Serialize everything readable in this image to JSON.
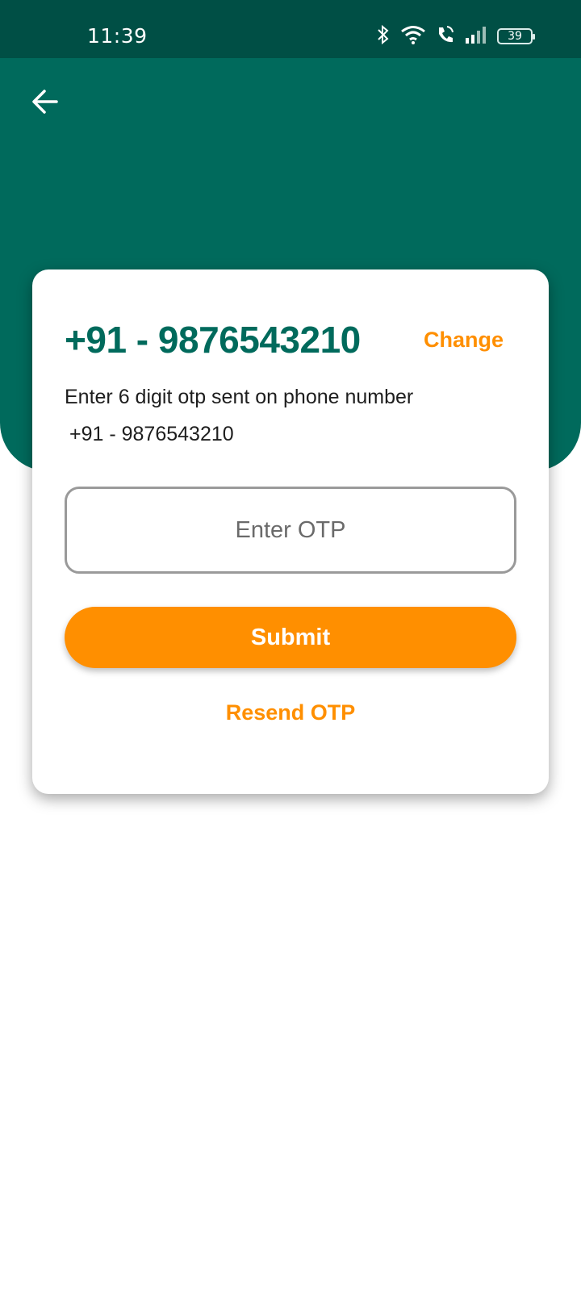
{
  "status_bar": {
    "time": "11:39",
    "battery": "39",
    "icons": [
      "bluetooth-icon",
      "wifi-icon",
      "call-icon",
      "signal-icon",
      "battery-icon"
    ]
  },
  "header": {
    "back_icon": "arrow-left-icon"
  },
  "card": {
    "phone_title": "+91 - 9876543210",
    "change_label": "Change",
    "instruction": "Enter 6 digit otp sent on phone number",
    "instruction_phone": "+91 - 9876543210",
    "otp_placeholder": "Enter OTP",
    "otp_value": "",
    "submit_label": "Submit",
    "resend_label": "Resend OTP"
  },
  "colors": {
    "status_bar": "#004f45",
    "primary": "#006a5c",
    "accent": "#ff8f00"
  }
}
